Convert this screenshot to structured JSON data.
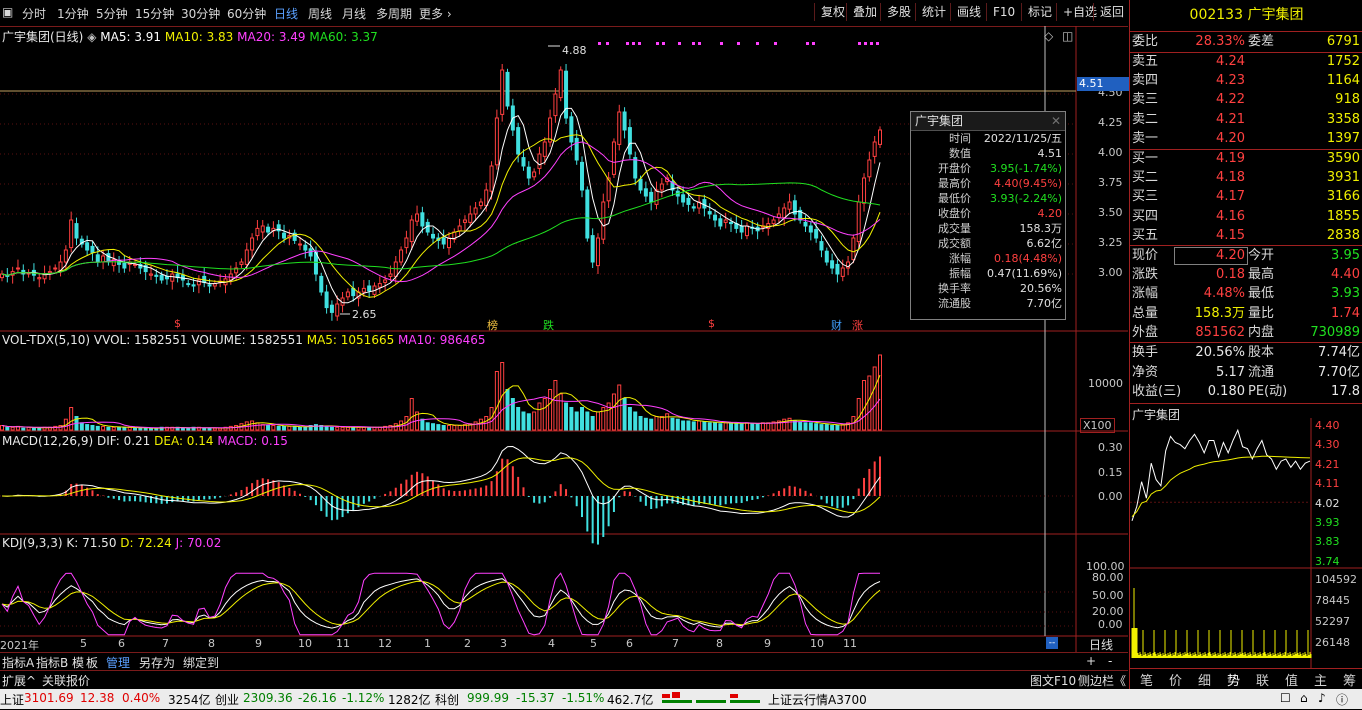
{
  "toolbar": {
    "tabs": [
      "分时",
      "1分钟",
      "5分钟",
      "15分钟",
      "30分钟",
      "60分钟",
      "日线",
      "周线",
      "月线",
      "多周期",
      "更多"
    ],
    "active_tab": "日线",
    "right_buttons": [
      "复权",
      "叠加",
      "多股",
      "统计",
      "画线",
      "F10",
      "标记",
      "+自选",
      "返回"
    ]
  },
  "stock": {
    "code": "002133",
    "name": "广宇集团"
  },
  "main_chart": {
    "title": "广宇集团(日线)",
    "ma": [
      {
        "label": "MA5: 3.91",
        "color": "#ffffff"
      },
      {
        "label": "MA10: 3.83",
        "color": "#f0f000"
      },
      {
        "label": "MA20: 3.49",
        "color": "#ff40ff"
      },
      {
        "label": "MA60: 3.37",
        "color": "#20e020"
      }
    ],
    "high_label": "4.88",
    "low_label": "2.65",
    "cursor_price": "4.51",
    "price_axis": [
      "4.50",
      "4.25",
      "4.00",
      "3.75",
      "3.50",
      "3.25",
      "3.00"
    ],
    "markers": [
      {
        "text": "$",
        "color": "#ff4040"
      },
      {
        "text": "榜",
        "color": "#f0c040"
      },
      {
        "text": "跌",
        "color": "#20e020"
      },
      {
        "text": "$",
        "color": "#ff4040"
      },
      {
        "text": "财",
        "color": "#40a0ff"
      },
      {
        "text": "涨",
        "color": "#ff4040"
      }
    ],
    "close_series": [
      3.0,
      2.98,
      3.02,
      3.05,
      3.0,
      3.01,
      2.99,
      2.97,
      3.0,
      3.02,
      3.05,
      3.1,
      3.2,
      3.45,
      3.3,
      3.25,
      3.2,
      3.18,
      3.1,
      3.15,
      3.1,
      3.12,
      3.08,
      3.05,
      3.1,
      3.08,
      3.05,
      3.02,
      3.0,
      2.98,
      2.95,
      2.96,
      3.0,
      2.97,
      2.95,
      2.92,
      2.9,
      2.95,
      2.93,
      2.9,
      2.92,
      2.94,
      2.96,
      3.0,
      3.05,
      3.1,
      3.2,
      3.3,
      3.38,
      3.4,
      3.35,
      3.38,
      3.36,
      3.3,
      3.32,
      3.28,
      3.25,
      3.2,
      3.15,
      3.0,
      2.85,
      2.72,
      2.68,
      2.75,
      2.8,
      2.85,
      2.82,
      2.85,
      2.88,
      2.86,
      2.9,
      2.92,
      2.95,
      3.0,
      3.1,
      3.2,
      3.3,
      3.45,
      3.5,
      3.4,
      3.35,
      3.3,
      3.28,
      3.25,
      3.3,
      3.35,
      3.4,
      3.45,
      3.5,
      3.55,
      3.6,
      3.7,
      3.9,
      4.3,
      4.7,
      4.4,
      4.2,
      4.0,
      3.9,
      3.8,
      3.85,
      4.0,
      4.1,
      4.3,
      4.5,
      4.7,
      4.3,
      4.1,
      3.95,
      3.7,
      3.3,
      3.1,
      3.3,
      3.6,
      3.8,
      4.1,
      4.35,
      4.2,
      4.0,
      3.8,
      3.7,
      3.65,
      3.6,
      3.7,
      3.75,
      3.8,
      3.7,
      3.65,
      3.6,
      3.58,
      3.55,
      3.6,
      3.55,
      3.5,
      3.45,
      3.4,
      3.45,
      3.42,
      3.38,
      3.35,
      3.4,
      3.38,
      3.36,
      3.4,
      3.42,
      3.45,
      3.5,
      3.55,
      3.6,
      3.5,
      3.45,
      3.4,
      3.35,
      3.3,
      3.2,
      3.1,
      3.05,
      3.0,
      3.05,
      3.1,
      3.3,
      3.6,
      3.8,
      3.95,
      4.1,
      4.2
    ]
  },
  "volume_chart": {
    "title": "VOL-TDX(5,10)",
    "vvol": "VVOL: 1582551",
    "volume": "VOLUME: 1582551",
    "ma5": "MA5: 1051665",
    "ma10": "MA10: 986465",
    "axis": "10000",
    "unit": "X100",
    "vol_series": [
      0.5,
      0.3,
      0.3,
      0.4,
      0.2,
      0.3,
      0.2,
      0.2,
      0.3,
      0.3,
      0.4,
      0.5,
      1.2,
      2.5,
      1.5,
      0.8,
      0.6,
      0.5,
      0.4,
      0.4,
      0.3,
      0.3,
      0.3,
      0.3,
      0.3,
      0.2,
      0.2,
      0.2,
      0.2,
      0.2,
      0.3,
      0.3,
      0.3,
      0.3,
      0.2,
      0.2,
      0.3,
      0.3,
      0.2,
      0.2,
      0.2,
      0.2,
      0.3,
      0.4,
      0.5,
      0.7,
      0.9,
      1.0,
      0.8,
      0.6,
      0.5,
      0.5,
      0.4,
      0.4,
      0.4,
      0.4,
      0.3,
      0.3,
      0.5,
      0.6,
      0.5,
      0.4,
      0.3,
      0.3,
      0.3,
      0.3,
      0.3,
      0.3,
      0.3,
      0.3,
      0.3,
      0.3,
      0.4,
      0.5,
      0.7,
      1.0,
      1.5,
      3.5,
      2.0,
      1.2,
      0.8,
      0.7,
      0.6,
      0.5,
      0.5,
      0.5,
      0.5,
      0.6,
      0.7,
      0.9,
      1.2,
      1.5,
      2.5,
      6.5,
      7.5,
      4.5,
      3.5,
      2.5,
      2.0,
      1.8,
      2.0,
      3.0,
      3.5,
      4.5,
      5.5,
      4.0,
      3.0,
      2.5,
      2.0,
      2.5,
      2.0,
      1.5,
      2.0,
      2.5,
      3.0,
      4.0,
      5.0,
      3.5,
      2.5,
      2.0,
      1.5,
      1.3,
      1.2,
      1.5,
      1.5,
      1.8,
      1.3,
      1.2,
      1.0,
      1.0,
      0.9,
      1.0,
      0.9,
      0.8,
      0.8,
      0.7,
      0.8,
      0.8,
      0.7,
      0.7,
      0.8,
      0.7,
      0.7,
      0.8,
      0.8,
      0.9,
      1.0,
      1.2,
      1.3,
      1.0,
      0.9,
      0.8,
      0.8,
      0.7,
      0.6,
      0.6,
      0.5,
      0.5,
      0.6,
      0.8,
      1.5,
      3.5,
      5.5,
      6.0,
      7.0,
      8.5
    ]
  },
  "macd_chart": {
    "title": "MACD(12,26,9)",
    "dif": "DIF: 0.21",
    "dea": "DEA: 0.14",
    "macd": "MACD: 0.15",
    "axis": [
      "0.30",
      "0.15",
      "0.00"
    ]
  },
  "kdj_chart": {
    "title": "KDJ(9,3,3)",
    "k": "K: 71.50",
    "d": "D: 72.24",
    "j": "J: 70.02",
    "axis": [
      "100.00",
      "80.00",
      "50.00",
      "20.00",
      "0.00"
    ]
  },
  "x_axis": {
    "labels": [
      "2021年",
      "5",
      "6",
      "7",
      "8",
      "9",
      "10",
      "11",
      "12",
      "1",
      "2",
      "3",
      "4",
      "5",
      "6",
      "7",
      "8",
      "9",
      "10",
      "11"
    ],
    "period": "日线"
  },
  "popup": {
    "title": "广宇集团",
    "rows": [
      {
        "k": "时间",
        "v": "2022/11/25/五",
        "c": "#e0e0e0"
      },
      {
        "k": "数值",
        "v": "4.51",
        "c": "#e0e0e0"
      },
      {
        "k": "开盘价",
        "v": "3.95(-1.74%)",
        "c": "#20e020"
      },
      {
        "k": "最高价",
        "v": "4.40(9.45%)",
        "c": "#ff4040"
      },
      {
        "k": "最低价",
        "v": "3.93(-2.24%)",
        "c": "#20e020"
      },
      {
        "k": "收盘价",
        "v": "4.20",
        "c": "#ff4040"
      },
      {
        "k": "成交量",
        "v": "158.3万",
        "c": "#e0e0e0"
      },
      {
        "k": "成交额",
        "v": "6.62亿",
        "c": "#e0e0e0"
      },
      {
        "k": "涨幅",
        "v": "0.18(4.48%)",
        "c": "#ff4040"
      },
      {
        "k": "振幅",
        "v": "0.47(11.69%)",
        "c": "#e0e0e0"
      },
      {
        "k": "换手率",
        "v": "20.56%",
        "c": "#e0e0e0"
      },
      {
        "k": "流通股",
        "v": "7.70亿",
        "c": "#e0e0e0"
      }
    ]
  },
  "bottombar": {
    "buttons": [
      "指标A",
      "指标B",
      "模",
      "板",
      "管理",
      "另存为",
      "绑定到"
    ],
    "second": [
      "扩展^",
      "关联报价"
    ],
    "right": [
      "图文F10",
      "侧边栏《"
    ]
  },
  "quote": {
    "webi_label": "委比",
    "webi": "28.33%",
    "weicha_label": "委差",
    "weicha": "6791",
    "sell": [
      {
        "label": "卖五",
        "price": "4.24",
        "vol": "1752"
      },
      {
        "label": "卖四",
        "price": "4.23",
        "vol": "1164"
      },
      {
        "label": "卖三",
        "price": "4.22",
        "vol": "918"
      },
      {
        "label": "卖二",
        "price": "4.21",
        "vol": "3358"
      },
      {
        "label": "卖一",
        "price": "4.20",
        "vol": "1397"
      }
    ],
    "buy": [
      {
        "label": "买一",
        "price": "4.19",
        "vol": "3590"
      },
      {
        "label": "买二",
        "price": "4.18",
        "vol": "3931"
      },
      {
        "label": "买三",
        "price": "4.17",
        "vol": "3166"
      },
      {
        "label": "买四",
        "price": "4.16",
        "vol": "1855"
      },
      {
        "label": "买五",
        "price": "4.15",
        "vol": "2838"
      }
    ],
    "stats": [
      {
        "l": "现价",
        "lv": "4.20",
        "lc": "#ff4040",
        "r": "今开",
        "rv": "3.95",
        "rc": "#20e020"
      },
      {
        "l": "涨跌",
        "lv": "0.18",
        "lc": "#ff4040",
        "r": "最高",
        "rv": "4.40",
        "rc": "#ff4040"
      },
      {
        "l": "涨幅",
        "lv": "4.48%",
        "lc": "#ff4040",
        "r": "最低",
        "rv": "3.93",
        "rc": "#20e020"
      },
      {
        "l": "总量",
        "lv": "158.3万",
        "lc": "#f0f000",
        "r": "量比",
        "rv": "1.74",
        "rc": "#ff4040"
      },
      {
        "l": "外盘",
        "lv": "851562",
        "lc": "#ff4040",
        "r": "内盘",
        "rv": "730989",
        "rc": "#20e020"
      }
    ],
    "stats2": [
      {
        "l": "换手",
        "lv": "20.56%",
        "r": "股本",
        "rv": "7.74亿"
      },
      {
        "l": "净资",
        "lv": "5.17",
        "r": "流通",
        "rv": "7.70亿"
      },
      {
        "l": "收益(三)",
        "lv": "0.180",
        "r": "PE(动)",
        "rv": "17.8"
      }
    ]
  },
  "mini_chart": {
    "title": "广宇集团",
    "price_axis": [
      "4.40",
      "4.30",
      "4.21",
      "4.11",
      "4.02",
      "3.93",
      "3.83",
      "3.74"
    ],
    "vol_axis": [
      "104592",
      "78445",
      "52297",
      "26148"
    ],
    "price_series": [
      3.95,
      4.0,
      4.1,
      4.05,
      4.2,
      4.15,
      4.1,
      4.25,
      4.35,
      4.3,
      4.32,
      4.28,
      4.3,
      4.36,
      4.3,
      4.28,
      4.32,
      4.3,
      4.25,
      4.3,
      4.28,
      4.32,
      4.35,
      4.3,
      4.27,
      4.25,
      4.28,
      4.3,
      4.26,
      4.22,
      4.2,
      4.22,
      4.21,
      4.2,
      4.21,
      4.2,
      4.21,
      4.2
    ]
  },
  "right_tabs": [
    "笔",
    "价",
    "细",
    "势",
    "联",
    "值",
    "主",
    "筹"
  ],
  "status": {
    "sh_label": "上证",
    "sh": "3101.69",
    "sh_chg": "12.38",
    "sh_pct": "0.40%",
    "sh_amt": "3254亿",
    "cy_label": "创业",
    "cy": "2309.36",
    "cy_chg": "-26.16",
    "cy_pct": "-1.12%",
    "cy_amt": "1282亿",
    "kc_label": "科创",
    "kc": "999.99",
    "kc_chg": "-15.37",
    "kc_pct": "-1.51%",
    "kc_amt": "462.7亿",
    "cloud": "上证云行情A3700"
  }
}
